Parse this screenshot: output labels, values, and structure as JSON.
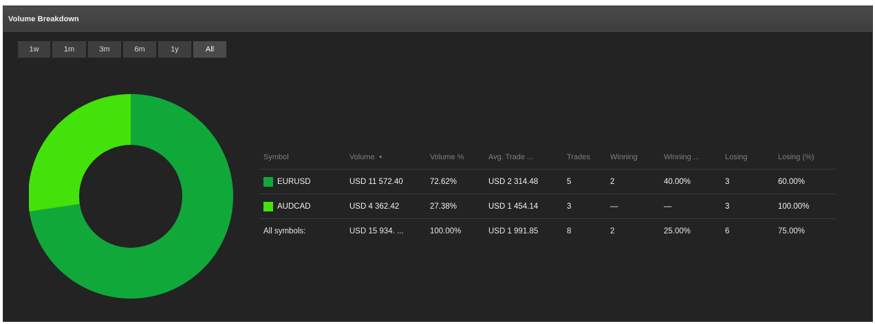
{
  "panel": {
    "title": "Volume Breakdown"
  },
  "ranges": [
    {
      "label": "1w"
    },
    {
      "label": "1m"
    },
    {
      "label": "3m"
    },
    {
      "label": "6m"
    },
    {
      "label": "1y"
    },
    {
      "label": "All"
    }
  ],
  "colors": {
    "EURUSD": "#11a83a",
    "AUDCAD": "#43e20b",
    "hole": "#232323"
  },
  "table": {
    "headers": [
      "Symbol",
      "Volume",
      "Volume %",
      "Avg. Trade ...",
      "Trades",
      "Winning",
      "Winning ...",
      "Losing",
      "Losing (%)"
    ],
    "sort_icon": "▼",
    "rows": [
      {
        "symbol": "EURUSD",
        "volume": "USD 11 572.40",
        "volume_pct": "72.62%",
        "avg_trade": "USD 2 314.48",
        "trades": "5",
        "winning": "2",
        "winning_pct": "40.00%",
        "losing": "3",
        "losing_pct": "60.00%"
      },
      {
        "symbol": "AUDCAD",
        "volume": "USD 4 362.42",
        "volume_pct": "27.38%",
        "avg_trade": "USD 1 454.14",
        "trades": "3",
        "winning": "—",
        "winning_pct": "—",
        "losing": "3",
        "losing_pct": "100.00%"
      }
    ],
    "total": {
      "symbol": "All symbols:",
      "volume": "USD 15 934. ...",
      "volume_pct": "100.00%",
      "avg_trade": "USD 1 991.85",
      "trades": "8",
      "winning": "2",
      "winning_pct": "25.00%",
      "losing": "6",
      "losing_pct": "75.00%"
    }
  },
  "chart_data": {
    "type": "pie",
    "categories": [
      "EURUSD",
      "AUDCAD"
    ],
    "values": [
      72.62,
      27.38
    ],
    "donut": true
  }
}
